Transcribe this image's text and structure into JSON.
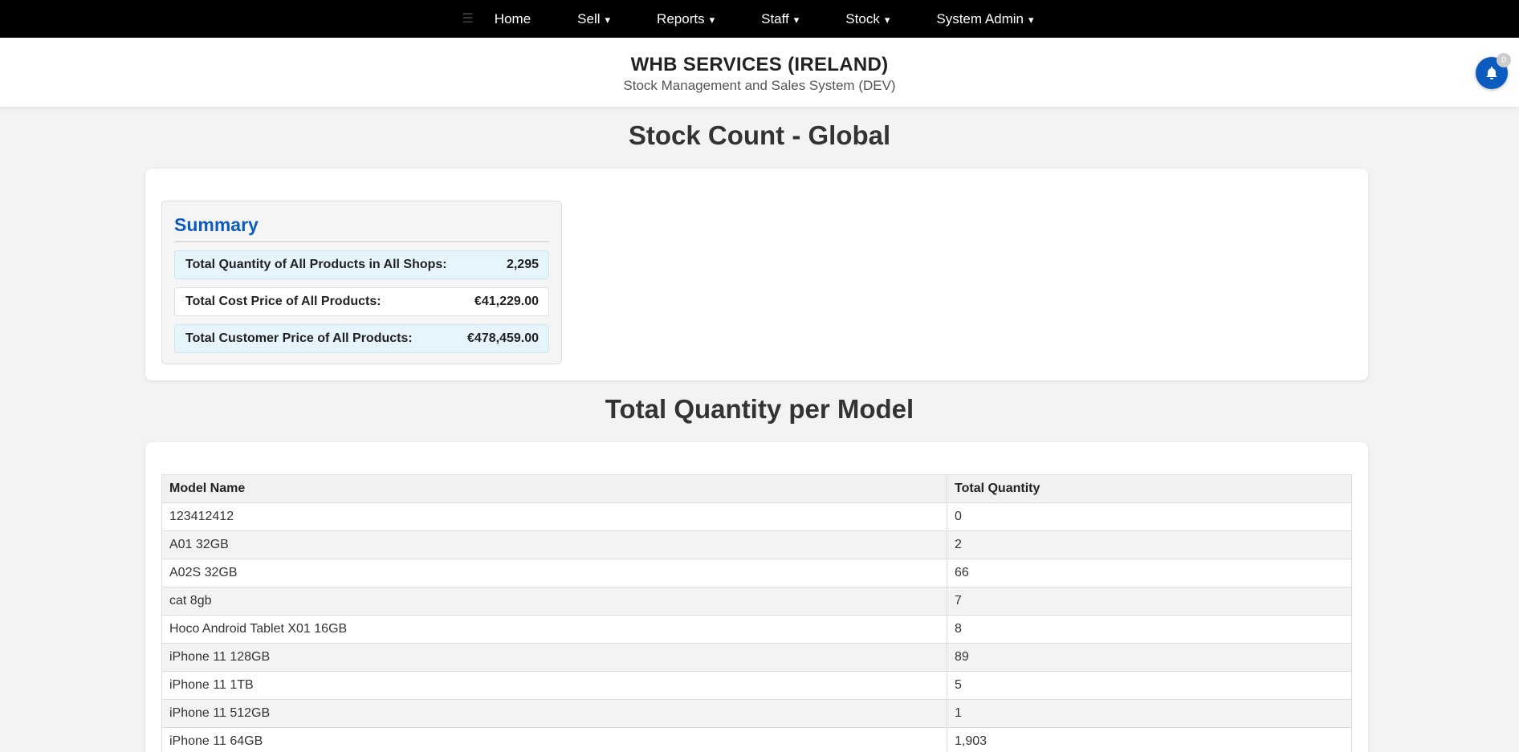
{
  "nav": {
    "home": "Home",
    "sell": "Sell",
    "reports": "Reports",
    "staff": "Staff",
    "stock": "Stock",
    "system_admin": "System Admin",
    "caret": "▾"
  },
  "header": {
    "brand": "WHB SERVICES (IRELAND)",
    "subtitle": "Stock Management and Sales System (DEV)",
    "notifications_count": "0"
  },
  "page_title": "Stock Count - Global",
  "summary": {
    "title": "Summary",
    "rows": [
      {
        "label": "Total Quantity of All Products in All Shops:",
        "value": "2,295"
      },
      {
        "label": "Total Cost Price of All Products:",
        "value": "€41,229.00"
      },
      {
        "label": "Total Customer Price of All Products:",
        "value": "€478,459.00"
      }
    ]
  },
  "models": {
    "title": "Total Quantity per Model",
    "columns": [
      "Model Name",
      "Total Quantity"
    ],
    "rows": [
      {
        "name": "123412412",
        "qty": "0"
      },
      {
        "name": "A01 32GB",
        "qty": "2"
      },
      {
        "name": "A02S 32GB",
        "qty": "66"
      },
      {
        "name": "cat 8gb",
        "qty": "7"
      },
      {
        "name": "Hoco Android Tablet X01 16GB",
        "qty": "8"
      },
      {
        "name": "iPhone 11 128GB",
        "qty": "89"
      },
      {
        "name": "iPhone 11 1TB",
        "qty": "5"
      },
      {
        "name": "iPhone 11 512GB",
        "qty": "1"
      },
      {
        "name": "iPhone 11 64GB",
        "qty": "1,903"
      }
    ]
  }
}
